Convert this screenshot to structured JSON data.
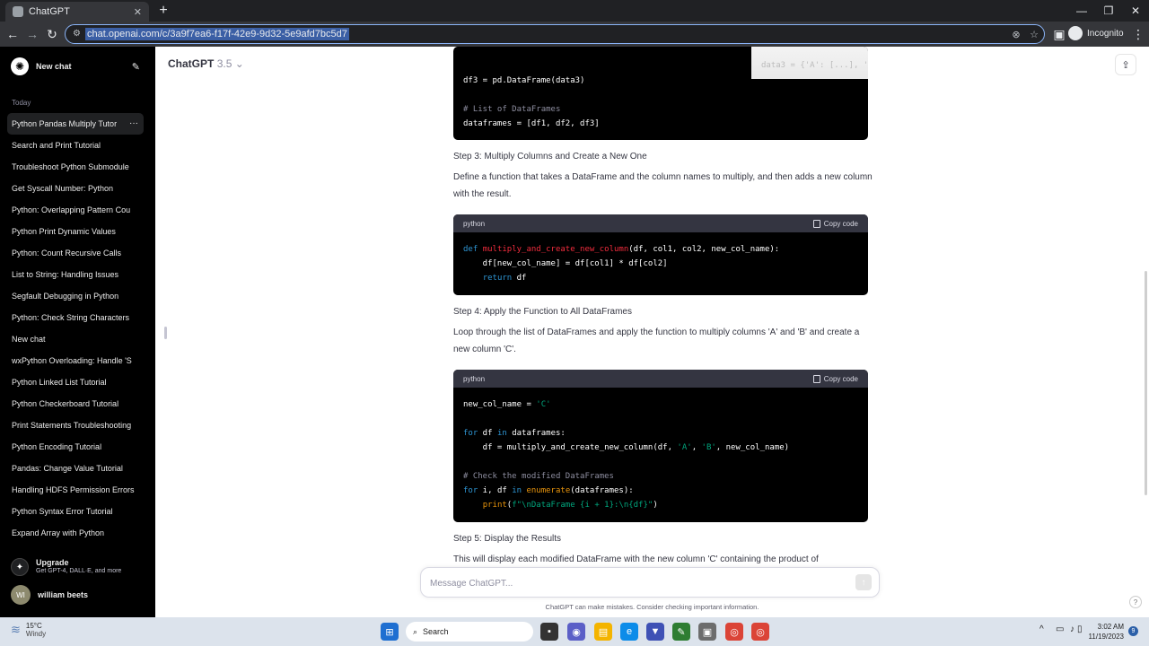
{
  "browser": {
    "tab_title": "ChatGPT",
    "tab_close": "✕",
    "new_tab": "+",
    "url": "chat.openai.com/c/3a9f7ea6-f17f-42e9-9d32-5e9afd7bc5d7",
    "profile_label": "Incognito"
  },
  "sidebar": {
    "new_chat_label": "New chat",
    "section_label": "Today",
    "items": [
      "Python Pandas Multiply Tutor",
      "Search and Print Tutorial",
      "Troubleshoot Python Submodule",
      "Get Syscall Number: Python",
      "Python: Overlapping Pattern Cou",
      "Python Print Dynamic Values",
      "Python: Count Recursive Calls",
      "List to String: Handling Issues",
      "Segfault Debugging in Python",
      "Python: Check String Characters",
      "New chat",
      "wxPython Overloading: Handle 'S",
      "Python Linked List Tutorial",
      "Python Checkerboard Tutorial",
      "Print Statements Troubleshooting",
      "Python Encoding Tutorial",
      "Pandas: Change Value Tutorial",
      "Handling HDFS Permission Errors",
      "Python Syntax Error Tutorial",
      "Expand Array with Python"
    ],
    "upgrade_title": "Upgrade",
    "upgrade_subtitle": "Get GPT-4, DALL·E, and more",
    "user_initials": "WI",
    "user_name": "william beets"
  },
  "header": {
    "model_name": "ChatGPT",
    "model_version": "3.5"
  },
  "content": {
    "code1_lines": [
      "df3 = pd.DataFrame(data3)",
      "",
      "# List of DataFrames",
      "dataframes = [df1, df2, df3]"
    ],
    "step3_title": "Step 3: Multiply Columns and Create a New One",
    "step3_text": "Define a function that takes a DataFrame and the column names to multiply, and then adds a new column with the result.",
    "code_lang": "python",
    "copy_label": "Copy code",
    "step4_title": "Step 4: Apply the Function to All DataFrames",
    "step4_text": "Loop through the list of DataFrames and apply the function to multiply columns 'A' and 'B' and create a new column 'C'.",
    "step5_title": "Step 5: Display the Results",
    "step5_text": "This will display each modified DataFrame with the new column 'C' containing the product of"
  },
  "composer": {
    "placeholder": "Message ChatGPT...",
    "disclaimer": "ChatGPT can make mistakes. Consider checking important information.",
    "help": "?"
  },
  "taskbar": {
    "temperature": "15°C",
    "weather": "Windy",
    "search_label": "Search",
    "time": "3:02 AM",
    "date": "11/19/2023",
    "notifications": "9"
  },
  "colors": {
    "sidebar_bg": "#000000",
    "code_bg": "#000000",
    "keyword": "#2e95d3",
    "function": "#f22c3d",
    "string": "#00a67d"
  }
}
